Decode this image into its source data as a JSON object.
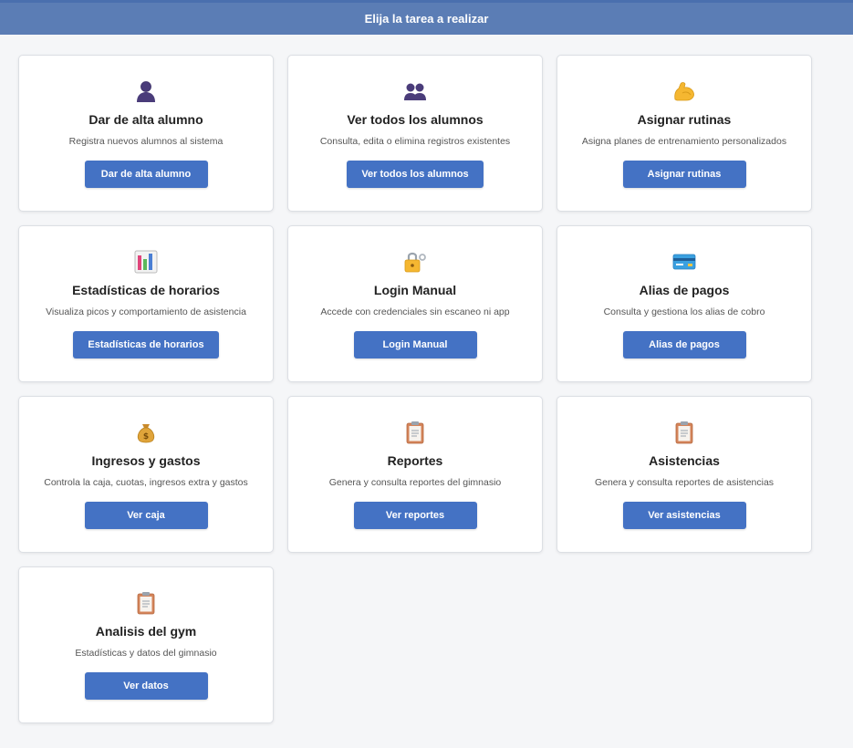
{
  "header": {
    "title": "Elija la tarea a realizar"
  },
  "colors": {
    "header_bg": "#5b7db5",
    "button_bg": "#4472c4",
    "page_bg": "#f5f6f8"
  },
  "cards": [
    {
      "icon": "person-silhouette-icon",
      "title": "Dar de alta alumno",
      "description": "Registra nuevos alumnos al sistema",
      "button": "Dar de alta alumno"
    },
    {
      "icon": "people-silhouette-icon",
      "title": "Ver todos los alumnos",
      "description": "Consulta, edita o elimina registros existentes",
      "button": "Ver todos los alumnos"
    },
    {
      "icon": "flexed-biceps-icon",
      "title": "Asignar rutinas",
      "description": "Asigna planes de entrenamiento personalizados",
      "button": "Asignar rutinas"
    },
    {
      "icon": "bar-chart-icon",
      "title": "Estadísticas de horarios",
      "description": "Visualiza picos y comportamiento de asistencia",
      "button": "Estadísticas de horarios"
    },
    {
      "icon": "lock-with-key-icon",
      "title": "Login Manual",
      "description": "Accede con credenciales sin escaneo ni app",
      "button": "Login Manual"
    },
    {
      "icon": "credit-card-icon",
      "title": "Alias de pagos",
      "description": "Consulta y gestiona los alias de cobro",
      "button": "Alias de pagos"
    },
    {
      "icon": "money-bag-icon",
      "title": "Ingresos y gastos",
      "description": "Controla la caja, cuotas, ingresos extra y gastos",
      "button": "Ver caja"
    },
    {
      "icon": "clipboard-icon",
      "title": "Reportes",
      "description": "Genera y consulta reportes del gimnasio",
      "button": "Ver reportes"
    },
    {
      "icon": "clipboard-icon",
      "title": "Asistencias",
      "description": "Genera y consulta reportes de asistencias",
      "button": "Ver asistencias"
    },
    {
      "icon": "clipboard-icon",
      "title": "Analisis del gym",
      "description": "Estadísticas y datos del gimnasio",
      "button": "Ver datos"
    }
  ]
}
